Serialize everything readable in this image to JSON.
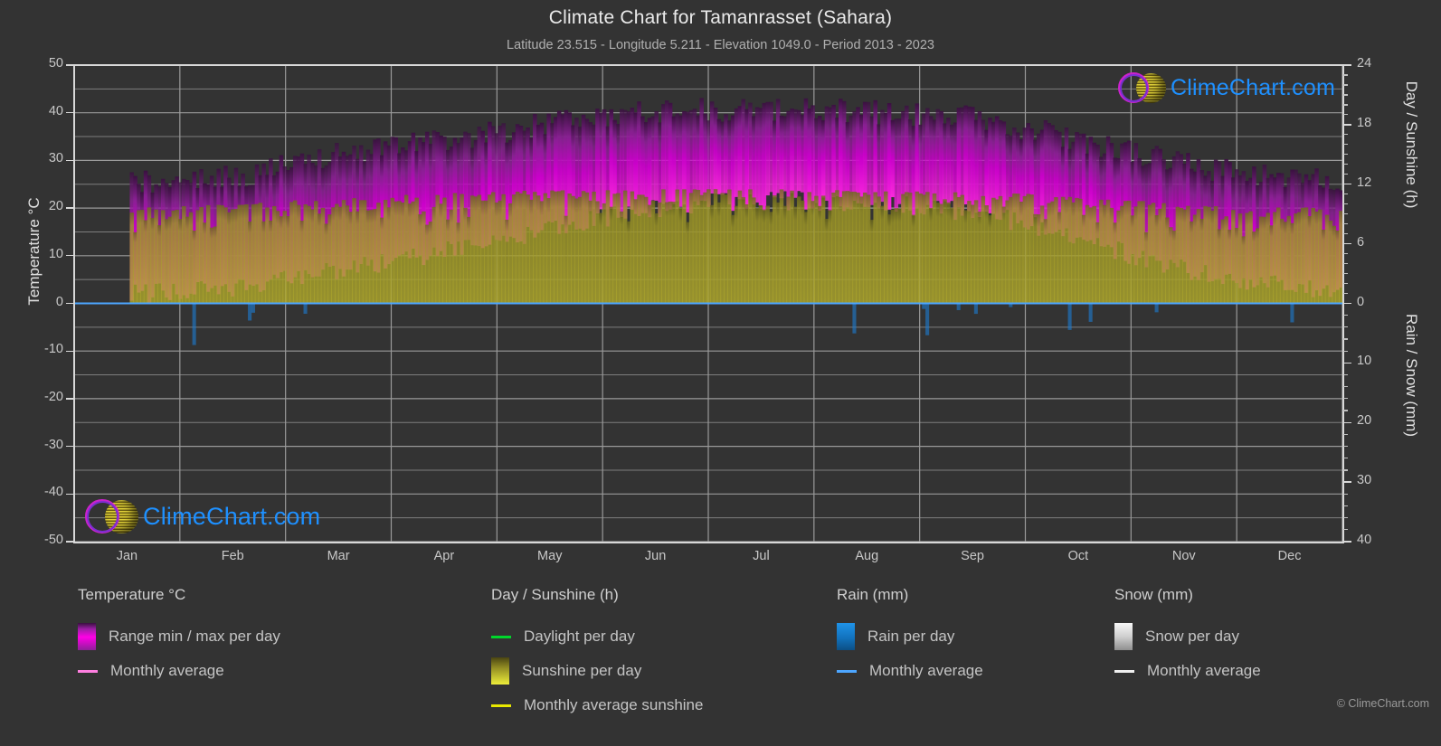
{
  "header": {
    "title": "Climate Chart for Tamanrasset (Sahara)",
    "subtitle": "Latitude 23.515 - Longitude 5.211 - Elevation 1049.0 - Period 2013 - 2023"
  },
  "branding": {
    "logo_text": "ClimeChart.com",
    "copyright": "© ClimeChart.com"
  },
  "axes": {
    "left_title": "Temperature °C",
    "right_title_top": "Day / Sunshine (h)",
    "right_title_bottom": "Rain / Snow (mm)",
    "left_ticks": [
      "50",
      "40",
      "30",
      "20",
      "10",
      "0",
      "-10",
      "-20",
      "-30",
      "-40",
      "-50"
    ],
    "right_ticks_top": [
      "24",
      "18",
      "12",
      "6",
      "0"
    ],
    "right_ticks_bottom": [
      "10",
      "20",
      "30",
      "40"
    ],
    "x_ticks": [
      "Jan",
      "Feb",
      "Mar",
      "Apr",
      "May",
      "Jun",
      "Jul",
      "Aug",
      "Sep",
      "Oct",
      "Nov",
      "Dec"
    ]
  },
  "legend": {
    "temperature": {
      "heading": "Temperature °C",
      "items": [
        {
          "label": "Range min / max per day",
          "marker": "gradient-box",
          "color": "#ff00e6"
        },
        {
          "label": "Monthly average",
          "marker": "line",
          "color": "#ff7fe0"
        }
      ]
    },
    "sunshine": {
      "heading": "Day / Sunshine (h)",
      "items": [
        {
          "label": "Daylight per day",
          "marker": "line",
          "color": "#00d72b"
        },
        {
          "label": "Sunshine per day",
          "marker": "gradient-box",
          "color": "#eded3a"
        },
        {
          "label": "Monthly average sunshine",
          "marker": "line",
          "color": "#e8e800"
        }
      ]
    },
    "rain": {
      "heading": "Rain (mm)",
      "items": [
        {
          "label": "Rain per day",
          "marker": "gradient-box",
          "color": "#1485d6"
        },
        {
          "label": "Monthly average",
          "marker": "line",
          "color": "#4da6ff"
        }
      ]
    },
    "snow": {
      "heading": "Snow (mm)",
      "items": [
        {
          "label": "Snow per day",
          "marker": "gradient-box",
          "color": "#e8e8e8"
        },
        {
          "label": "Monthly average",
          "marker": "line",
          "color": "#f0f0f0"
        }
      ]
    }
  },
  "colors": {
    "background": "#333333",
    "grid": "#8f8f8f",
    "axis": "#d8d8d8",
    "text": "#c8c8c8",
    "temp_range": "#cc00cc",
    "temp_avg": "#ff7fe0",
    "daylight": "#00d72b",
    "sunshine_fill": "#a8a329",
    "sunshine_avg": "#e8e800",
    "rain": "#1e78c8",
    "logo_text": "#1e90ff",
    "logo_ring": "#cc22cc",
    "logo_globe": "#d6c820"
  },
  "chart_data": {
    "type": "area",
    "title": "Climate Chart for Tamanrasset (Sahara)",
    "subtitle": "Latitude 23.515 - Longitude 5.211 - Elevation 1049.0 - Period 2013 - 2023",
    "xlabel": "",
    "ylabel": "Temperature °C",
    "ylabel_right_top": "Day / Sunshine (h)",
    "ylabel_right_bottom": "Rain / Snow (mm)",
    "categories": [
      "Jan",
      "Feb",
      "Mar",
      "Apr",
      "May",
      "Jun",
      "Jul",
      "Aug",
      "Sep",
      "Oct",
      "Nov",
      "Dec"
    ],
    "ylim": [
      -50,
      50
    ],
    "ylim_right_top": [
      0,
      24
    ],
    "ylim_right_bottom": [
      0,
      40
    ],
    "grid": true,
    "legend_position": "below",
    "series": [
      {
        "name": "Monthly average",
        "unit": "°C",
        "axis": "left",
        "color": "#ff7fe0",
        "values": [
          15.0,
          15.2,
          18.5,
          21.5,
          26.5,
          31.5,
          32.8,
          32.5,
          31.0,
          25.5,
          19.2,
          18.5
        ]
      },
      {
        "name": "Range max per day",
        "unit": "°C",
        "axis": "left",
        "color": "#cc00cc",
        "values": [
          25.5,
          26.5,
          31.0,
          34.0,
          37.5,
          40.0,
          40.5,
          40.0,
          38.5,
          34.0,
          29.0,
          26.0
        ]
      },
      {
        "name": "Range min per day",
        "unit": "°C",
        "axis": "left",
        "color": "#cc00cc",
        "values": [
          2.0,
          3.5,
          7.0,
          11.0,
          15.5,
          20.0,
          21.5,
          21.0,
          19.0,
          13.5,
          7.0,
          3.5
        ]
      },
      {
        "name": "Daylight per day",
        "unit": "h",
        "axis": "right_top",
        "color": "#00d72b",
        "values": [
          10.9,
          11.4,
          12.0,
          12.7,
          13.3,
          13.6,
          13.4,
          12.9,
          12.2,
          11.5,
          11.0,
          10.8
        ]
      },
      {
        "name": "Monthly average sunshine",
        "unit": "h",
        "axis": "right_top",
        "color": "#e8e800",
        "values": [
          9.7,
          10.1,
          10.6,
          11.1,
          11.4,
          11.5,
          11.5,
          11.4,
          11.2,
          10.8,
          10.0,
          9.7
        ]
      },
      {
        "name": "Rain monthly average",
        "unit": "mm",
        "axis": "right_bottom",
        "color": "#4da6ff",
        "values": [
          0.1,
          0.1,
          0.2,
          0.2,
          0.3,
          0.4,
          0.6,
          0.8,
          0.5,
          0.2,
          0.1,
          0.1
        ]
      },
      {
        "name": "Snow monthly average",
        "unit": "mm",
        "axis": "right_bottom",
        "color": "#f0f0f0",
        "values": [
          0,
          0,
          0,
          0,
          0,
          0,
          0,
          0,
          0,
          0,
          0,
          0
        ]
      }
    ]
  }
}
